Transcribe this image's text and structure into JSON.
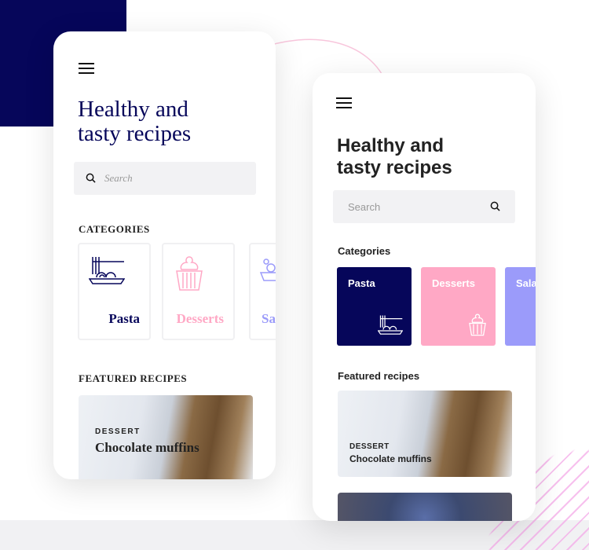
{
  "colors": {
    "navy": "#06065a",
    "pink": "#ffa8c5",
    "lavender": "#9b9bfa"
  },
  "phone_left": {
    "title_line1": "Healthy and",
    "title_line2": "tasty recipes",
    "search_placeholder": "Search",
    "categories_heading": "CATEGORIES",
    "categories": [
      {
        "label": "Pasta",
        "icon": "pasta-icon"
      },
      {
        "label": "Desserts",
        "icon": "cupcake-icon"
      },
      {
        "label": "Sa",
        "icon": "salad-icon"
      }
    ],
    "featured_heading": "FEATURED RECIPES",
    "featured": {
      "category": "DESSERT",
      "name": "Chocolate muffins"
    }
  },
  "phone_right": {
    "title_line1": "Healthy and",
    "title_line2": "tasty recipes",
    "search_placeholder": "Search",
    "categories_heading": "Categories",
    "categories": [
      {
        "label": "Pasta",
        "icon": "pasta-icon"
      },
      {
        "label": "Desserts",
        "icon": "cupcake-icon"
      },
      {
        "label": "Sala",
        "icon": "salad-icon"
      }
    ],
    "featured_heading": "Featured recipes",
    "featured": {
      "category": "DESSERT",
      "name": "Chocolate muffins"
    }
  }
}
